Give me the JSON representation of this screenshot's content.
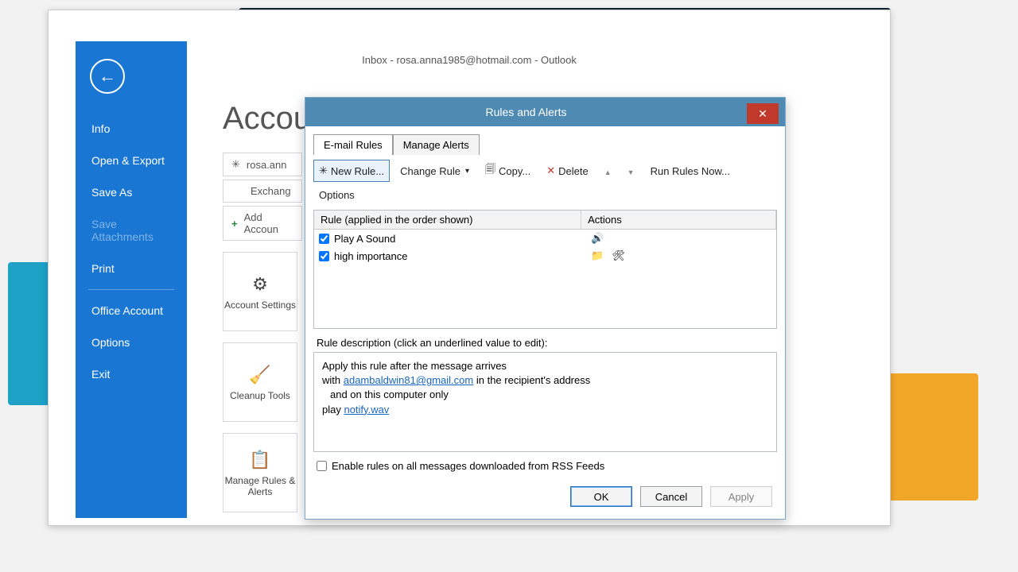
{
  "window_title": "Inbox - rosa.anna1985@hotmail.com - Outlook",
  "page_header": "Accou",
  "sidebar": {
    "items": [
      "Info",
      "Open & Export",
      "Save As",
      "Save Attachments",
      "Print",
      "Office Account",
      "Options",
      "Exit"
    ]
  },
  "behind": {
    "row1": "rosa.ann",
    "row2": "Exchang",
    "add_account": "Add Accoun",
    "cards": [
      "Account Settings",
      "Cleanup Tools",
      "Manage Rules & Alerts"
    ]
  },
  "dialog": {
    "title": "Rules and Alerts",
    "tabs": [
      "E-mail Rules",
      "Manage Alerts"
    ],
    "toolbar": {
      "new": "New Rule...",
      "change": "Change Rule",
      "copy": "Copy...",
      "delete": "Delete",
      "run": "Run Rules Now...",
      "options": "Options"
    },
    "columns": {
      "rule": "Rule (applied in the order shown)",
      "actions": "Actions"
    },
    "rules": [
      {
        "name": "Play A Sound",
        "checked": true,
        "actions": [
          "sound"
        ]
      },
      {
        "name": "high importance",
        "checked": true,
        "actions": [
          "folder",
          "filter"
        ]
      }
    ],
    "desc_label": "Rule description (click an underlined value to edit):",
    "desc": {
      "l1": "Apply this rule after the message arrives",
      "l2a": "with ",
      "email": "adambaldwin81@gmail.com",
      "l2b": " in the recipient's address",
      "l3": "and on this computer only",
      "l4a": "play ",
      "file": "notify.wav"
    },
    "rss": "Enable rules on all messages downloaded from RSS Feeds",
    "buttons": {
      "ok": "OK",
      "cancel": "Cancel",
      "apply": "Apply"
    }
  }
}
